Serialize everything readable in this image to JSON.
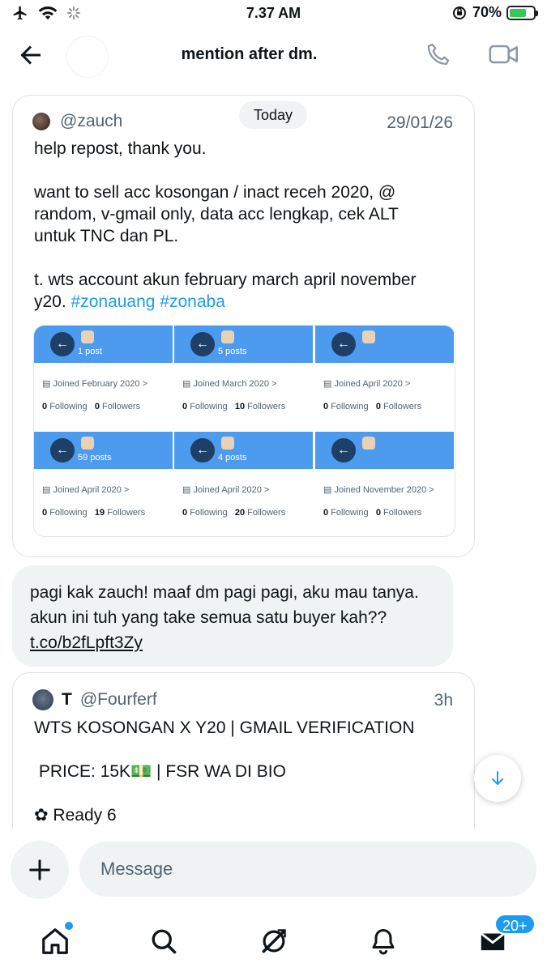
{
  "status_bar": {
    "time": "7.37 AM",
    "battery": "70%",
    "battery_level": 0.7,
    "icons": [
      "airplane-icon",
      "wifi-icon",
      "loading-icon",
      "orientation-lock-icon",
      "battery-charging-icon"
    ]
  },
  "header": {
    "title": "mention after dm.",
    "icons": [
      "back-arrow-icon",
      "phone-icon",
      "video-icon"
    ]
  },
  "date_divider": "Today",
  "quoted_tweet_1": {
    "handle": "@zauch",
    "date": "29/01/26",
    "text_plain": "help repost, thank you.\n\nwant to sell acc kosongan / inact receh 2020, @\nrandom, v-gmail only, data acc lengkap, cek ALT\nuntuk TNC dan PL.\n\nt. wts account akun february march april november\ny20. ",
    "hashtags": "#zonauang #zonaba",
    "profiles": [
      {
        "posts": "1 post",
        "joined": "Joined February 2020 >",
        "following": "0",
        "followers": "0"
      },
      {
        "posts": "5 posts",
        "joined": "Joined March 2020 >",
        "following": "0",
        "followers": "10"
      },
      {
        "posts": "",
        "joined": "Joined April 2020 >",
        "following": "0",
        "followers": "0"
      },
      {
        "posts": "59 posts",
        "joined": "Joined April 2020 >",
        "following": "0",
        "followers": "19"
      },
      {
        "posts": "4 posts",
        "joined": "Joined April 2020 >",
        "following": "0",
        "followers": "20"
      },
      {
        "posts": "",
        "joined": "Joined November 2020 >",
        "following": "0",
        "followers": "0"
      }
    ],
    "following_label": "Following",
    "followers_label": "Followers"
  },
  "message": {
    "text": "pagi kak zauch! maaf dm pagi pagi, aku mau tanya. akun ini tuh yang take semua satu buyer kah?? ",
    "link": "t.co/b2fLpft3Zy"
  },
  "quoted_tweet_2": {
    "name": "T",
    "handle": "@Fourferf",
    "time": "3h",
    "text": "WTS KOSONGAN X Y20 | GMAIL VERIFICATION\n\n PRICE: 15K💵 | FSR WA DI BIO\n\n✿ Ready 6"
  },
  "composer": {
    "placeholder": "Message",
    "value": ""
  },
  "bottom_nav": {
    "items": [
      "home-icon",
      "search-icon",
      "grok-icon",
      "notifications-icon",
      "messages-icon"
    ],
    "dm_badge": "20+"
  },
  "colors": {
    "accent": "#1d9bf0",
    "banner": "#4d9bef",
    "bubble": "#eff3f4",
    "text": "#0f1419",
    "muted": "#536471"
  }
}
